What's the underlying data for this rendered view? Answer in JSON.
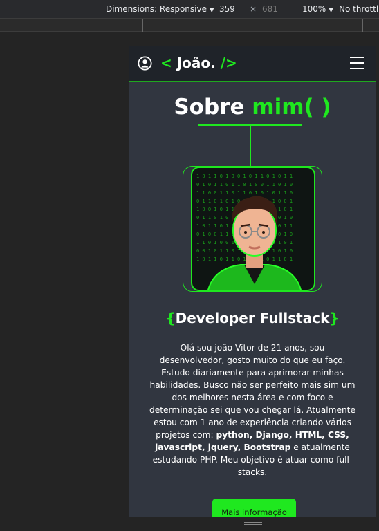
{
  "devtools": {
    "dimensions_label": "Dimensions: Responsive",
    "width": "359",
    "times": "×",
    "height": "681",
    "zoom": "100%",
    "throttling": "No throttlin"
  },
  "nav": {
    "logo_open": "<",
    "logo_name": "João.",
    "logo_close": "/>"
  },
  "section": {
    "title_white": "Sobre",
    "title_green": "mim( )"
  },
  "profile": {
    "brace_open": "{",
    "role": "Developer Fullstack",
    "brace_close": "}"
  },
  "bio": {
    "intro": "Olá sou joão Vitor de 21 anos, sou desenvolvedor, gosto muito do que eu faço. Estudo diariamente para aprimorar minhas habilidades. Busco não ser perfeito mais sim um dos melhores nesta área e com foco e determinação sei que vou chegar lá. Atualmente estou com 1 ano de experiência criando vários projetos com:",
    "skills": "python, Django, HTML, CSS, javascript, jquery, Bootstrap",
    "outro": "e atualmente estudando PHP. Meu objetivo é atuar como full-stacks."
  },
  "cta": {
    "label": "Mais informação"
  },
  "colors": {
    "accent": "#1fe81f",
    "nav_bg": "#1f2329",
    "page_bg": "#313640",
    "outer_bg": "#242424"
  },
  "icons": [
    "user-circle-icon",
    "hamburger-menu-icon",
    "dropdown-caret-icon",
    "resize-handle-icon"
  ]
}
